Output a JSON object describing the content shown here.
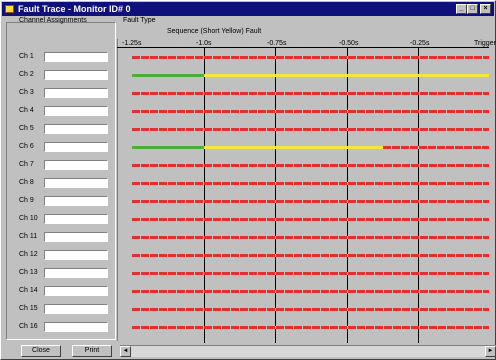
{
  "window": {
    "title": "Fault Trace - Monitor ID# 0"
  },
  "titlebar_buttons": {
    "minimize": "_",
    "maximize": "□",
    "close": "×"
  },
  "left_panel": {
    "heading": "Channel Assignments"
  },
  "channels": [
    {
      "label": "Ch 1",
      "value": ""
    },
    {
      "label": "Ch 2",
      "value": ""
    },
    {
      "label": "Ch 3",
      "value": ""
    },
    {
      "label": "Ch 4",
      "value": ""
    },
    {
      "label": "Ch 5",
      "value": ""
    },
    {
      "label": "Ch 6",
      "value": ""
    },
    {
      "label": "Ch 7",
      "value": ""
    },
    {
      "label": "Ch 8",
      "value": ""
    },
    {
      "label": "Ch 9",
      "value": ""
    },
    {
      "label": "Ch 10",
      "value": ""
    },
    {
      "label": "Ch 11",
      "value": ""
    },
    {
      "label": "Ch 12",
      "value": ""
    },
    {
      "label": "Ch 13",
      "value": ""
    },
    {
      "label": "Ch 14",
      "value": ""
    },
    {
      "label": "Ch 15",
      "value": ""
    },
    {
      "label": "Ch 16",
      "value": ""
    }
  ],
  "fault": {
    "heading": "Fault Type",
    "description": "Sequence (Short Yellow) Fault"
  },
  "time_axis": {
    "ticks": [
      "-1.25s",
      "-1.0s",
      "-0.75s",
      "-0.50s",
      "-0.25s",
      "Trigger"
    ]
  },
  "traces": [
    {
      "channel": "Ch 2",
      "segments": [
        {
          "color": "#4caf3a",
          "from": "-1.25s",
          "to": "-1.0s"
        },
        {
          "color": "#f0e63c",
          "from": "-1.0s",
          "to": "Trigger"
        }
      ]
    },
    {
      "channel": "Ch 6",
      "segments": [
        {
          "color": "#4caf3a",
          "from": "-1.25s",
          "to": "-1.0s"
        },
        {
          "color": "#f0e63c",
          "from": "-1.0s",
          "to": "-0.37s"
        },
        {
          "color": "#e03030",
          "from": "-0.37s",
          "to": "Trigger"
        }
      ]
    }
  ],
  "colors": {
    "red": "#e03030",
    "yellow": "#f0e63c",
    "green": "#4caf3a",
    "titlebar": "#10107a"
  },
  "buttons": {
    "close": "Close",
    "print": "Print"
  },
  "scrollbar": {
    "left_arrow": "◄",
    "right_arrow": "►"
  }
}
